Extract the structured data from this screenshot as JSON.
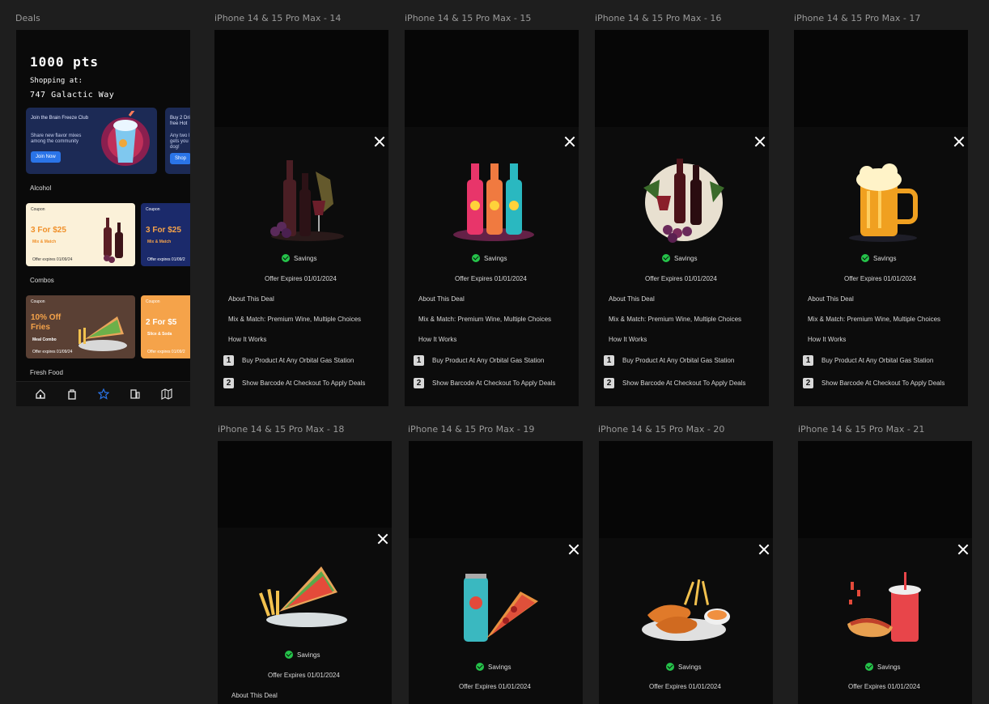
{
  "home": {
    "frame_label": "Deals",
    "points": "1000 pts",
    "shopping_at": "Shopping at:",
    "address": "747 Galactic Way",
    "promo1": {
      "title": "Join the Brain Freeze Club",
      "desc": "Share new flavor mixes among the community",
      "button": "Join Now"
    },
    "promo2": {
      "title": "Buy 2 Dri free Hot",
      "desc": "Any two l gets you dog!",
      "button": "Shop"
    },
    "sections": {
      "alcohol": "Alcohol",
      "combos": "Combos",
      "fresh": "Fresh Food"
    },
    "coupons": {
      "a1": {
        "tag": "Coupon",
        "title": "3 For $25",
        "sub": "Mix & Match",
        "exp": "Offer expires 01/09/24"
      },
      "a2": {
        "tag": "Coupon",
        "title": "3 For $25",
        "sub": "Mix & Match",
        "exp": "Offer expires 01/09/2"
      },
      "c1": {
        "tag": "Coupon",
        "title": "10% Off Fries",
        "sub": "Meal Combo",
        "exp": "Offer expires 01/09/24"
      },
      "c2": {
        "tag": "Coupon",
        "title": "2 For $5",
        "sub": "Slice & Soda",
        "exp": "Offer expires 01/09/2"
      }
    },
    "nav_icons": [
      "home-icon",
      "bag-icon",
      "star-icon",
      "receipt-icon",
      "map-icon"
    ],
    "colors": {
      "accent_blue": "#2a74e8",
      "cream": "#fbf1d9",
      "orange": "#f5a34a",
      "navy": "#1b2a6b",
      "brown": "#5a4034"
    }
  },
  "details": [
    {
      "label": "iPhone 14 & 15 Pro Max - 14",
      "image": "wine-bottles-image",
      "savings": "Savings",
      "expires": "Offer Expires 01/01/2024",
      "about": "About This Deal",
      "deal": "Mix & Match: Premium Wine, Multiple Choices",
      "how": "How It Works",
      "step1": "Buy Product At Any Orbital Gas Station",
      "step2": "Show Barcode At Checkout To Apply Deals"
    },
    {
      "label": "iPhone 14 & 15 Pro Max - 15",
      "image": "soda-bottles-image",
      "savings": "Savings",
      "expires": "Offer Expires 01/01/2024",
      "about": "About This Deal",
      "deal": "Mix & Match: Premium Wine, Multiple Choices",
      "how": "How It Works",
      "step1": "Buy Product At Any Orbital Gas Station",
      "step2": "Show Barcode At Checkout To Apply Deals"
    },
    {
      "label": "iPhone 14 & 15 Pro Max - 16",
      "image": "wine-grapes-image",
      "savings": "Savings",
      "expires": "Offer Expires 01/01/2024",
      "about": "About This Deal",
      "deal": "Mix & Match: Premium Wine, Multiple Choices",
      "how": "How It Works",
      "step1": "Buy Product At Any Orbital Gas Station",
      "step2": "Show Barcode At Checkout To Apply Deals"
    },
    {
      "label": "iPhone 14 & 15 Pro Max - 17",
      "image": "beer-mug-image",
      "savings": "Savings",
      "expires": "Offer Expires 01/01/2024",
      "about": "About This Deal",
      "deal": "Mix & Match: Premium Wine, Multiple Choices",
      "how": "How It Works",
      "step1": "Buy Product At Any Orbital Gas Station",
      "step2": "Show Barcode At Checkout To Apply Deals"
    },
    {
      "label": "iPhone 14 & 15 Pro Max - 18",
      "image": "sandwich-fries-image",
      "savings": "Savings",
      "expires": "Offer Expires 01/01/2024",
      "about": "About This Deal"
    },
    {
      "label": "iPhone 14 & 15 Pro Max - 19",
      "image": "soda-pizza-image",
      "savings": "Savings",
      "expires": "Offer Expires 01/01/2024"
    },
    {
      "label": "iPhone 14 & 15 Pro Max - 20",
      "image": "chicken-fries-image",
      "savings": "Savings",
      "expires": "Offer Expires 01/01/2024"
    },
    {
      "label": "iPhone 14 & 15 Pro Max - 21",
      "image": "hotdog-soda-image",
      "savings": "Savings",
      "expires": "Offer Expires 01/01/2024"
    }
  ]
}
